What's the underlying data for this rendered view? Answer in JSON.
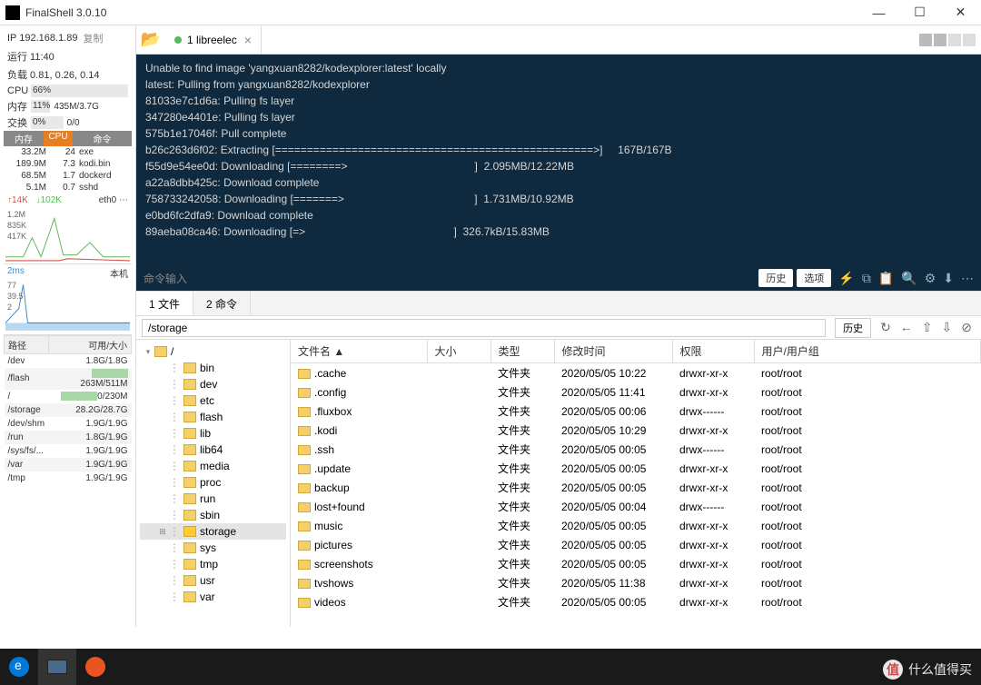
{
  "app": {
    "title": "FinalShell 3.0.10"
  },
  "sidebar": {
    "ip": "IP 192.168.1.89",
    "copy": "复制",
    "uptime": "运行 11:40",
    "load": "负载 0.81, 0.26, 0.14",
    "cpu": {
      "label": "CPU",
      "pct": "66%",
      "fill": 66,
      "color": "#8cd98c"
    },
    "mem": {
      "label": "内存",
      "pct": "11%",
      "fill": 11,
      "color": "#f0ad4e",
      "extra": "435M/3.7G"
    },
    "swap": {
      "label": "交换",
      "pct": "0%",
      "fill": 0,
      "extra": "0/0"
    },
    "proc_headers": {
      "mem": "内存",
      "cpu": "CPU",
      "cmd": "命令"
    },
    "procs": [
      {
        "mem": "33.2M",
        "cpu": "24",
        "cmd": "exe"
      },
      {
        "mem": "189.9M",
        "cpu": "7.3",
        "cmd": "kodi.bin"
      },
      {
        "mem": "68.5M",
        "cpu": "1.7",
        "cmd": "dockerd"
      },
      {
        "mem": "5.1M",
        "cpu": "0.7",
        "cmd": "sshd"
      }
    ],
    "net": {
      "up": "↑14K",
      "down": "↓102K",
      "iface": "eth0 ⋯"
    },
    "graph1_labels": [
      "1.2M",
      "835K",
      "417K"
    ],
    "ping": "2ms",
    "host": "本机",
    "graph2_labels": [
      "77",
      "39.5",
      "2"
    ],
    "path_headers": {
      "path": "路径",
      "avail": "可用/大小"
    },
    "paths": [
      {
        "path": "/dev",
        "avail": "1.8G/1.8G",
        "bar": 0
      },
      {
        "path": "/flash",
        "avail": "263M/511M",
        "bar": 50,
        "shade": true
      },
      {
        "path": "/",
        "avail": "0/230M",
        "bar": 100
      },
      {
        "path": "/storage",
        "avail": "28.2G/28.7G",
        "bar": 0,
        "shade": true
      },
      {
        "path": "/dev/shm",
        "avail": "1.9G/1.9G",
        "bar": 0
      },
      {
        "path": "/run",
        "avail": "1.8G/1.9G",
        "bar": 0,
        "shade": true
      },
      {
        "path": "/sys/fs/...",
        "avail": "1.9G/1.9G",
        "bar": 0
      },
      {
        "path": "/var",
        "avail": "1.9G/1.9G",
        "bar": 0,
        "shade": true
      },
      {
        "path": "/tmp",
        "avail": "1.9G/1.9G",
        "bar": 0
      }
    ]
  },
  "tab": {
    "label": "1 libreelec"
  },
  "terminal": {
    "lines": [
      "Unable to find image 'yangxuan8282/kodexplorer:latest' locally",
      "latest: Pulling from yangxuan8282/kodexplorer",
      "81033e7c1d6a: Pulling fs layer",
      "347280e4401e: Pulling fs layer",
      "575b1e17046f: Pull complete",
      "b26c263d6f02: Extracting [==================================================>]     167B/167B",
      "f55d9e54ee0d: Downloading [========>                                          ]  2.095MB/12.22MB",
      "a22a8dbb425c: Download complete",
      "758733242058: Downloading [=======>                                           ]  1.731MB/10.92MB",
      "e0bd6fc2dfa9: Download complete",
      "89aeba08ca46: Downloading [=>                                                 ]  326.7kB/15.83MB"
    ],
    "input_ph": "命令输入",
    "history": "历史",
    "options": "选项"
  },
  "lowertabs": {
    "files": "1 文件",
    "cmd": "2 命令"
  },
  "cwd": "/storage",
  "path_history": "历史",
  "tree": {
    "root": "/",
    "items": [
      "bin",
      "dev",
      "etc",
      "flash",
      "lib",
      "lib64",
      "media",
      "proc",
      "run",
      "sbin",
      "storage",
      "sys",
      "tmp",
      "usr",
      "var"
    ]
  },
  "filecols": {
    "name": "文件名 ▲",
    "size": "大小",
    "type": "类型",
    "mtime": "修改时间",
    "perm": "权限",
    "owner": "用户/用户组"
  },
  "foldertype": "文件夹",
  "files": [
    {
      "name": ".cache",
      "mtime": "2020/05/05 10:22",
      "perm": "drwxr-xr-x",
      "owner": "root/root"
    },
    {
      "name": ".config",
      "mtime": "2020/05/05 11:41",
      "perm": "drwxr-xr-x",
      "owner": "root/root"
    },
    {
      "name": ".fluxbox",
      "mtime": "2020/05/05 00:06",
      "perm": "drwx------",
      "owner": "root/root"
    },
    {
      "name": ".kodi",
      "mtime": "2020/05/05 10:29",
      "perm": "drwxr-xr-x",
      "owner": "root/root"
    },
    {
      "name": ".ssh",
      "mtime": "2020/05/05 00:05",
      "perm": "drwx------",
      "owner": "root/root"
    },
    {
      "name": ".update",
      "mtime": "2020/05/05 00:05",
      "perm": "drwxr-xr-x",
      "owner": "root/root"
    },
    {
      "name": "backup",
      "mtime": "2020/05/05 00:05",
      "perm": "drwxr-xr-x",
      "owner": "root/root"
    },
    {
      "name": "lost+found",
      "mtime": "2020/05/05 00:04",
      "perm": "drwx------",
      "owner": "root/root"
    },
    {
      "name": "music",
      "mtime": "2020/05/05 00:05",
      "perm": "drwxr-xr-x",
      "owner": "root/root"
    },
    {
      "name": "pictures",
      "mtime": "2020/05/05 00:05",
      "perm": "drwxr-xr-x",
      "owner": "root/root"
    },
    {
      "name": "screenshots",
      "mtime": "2020/05/05 00:05",
      "perm": "drwxr-xr-x",
      "owner": "root/root"
    },
    {
      "name": "tvshows",
      "mtime": "2020/05/05 11:38",
      "perm": "drwxr-xr-x",
      "owner": "root/root"
    },
    {
      "name": "videos",
      "mtime": "2020/05/05 00:05",
      "perm": "drwxr-xr-x",
      "owner": "root/root"
    }
  ],
  "watermark": "什么值得买"
}
